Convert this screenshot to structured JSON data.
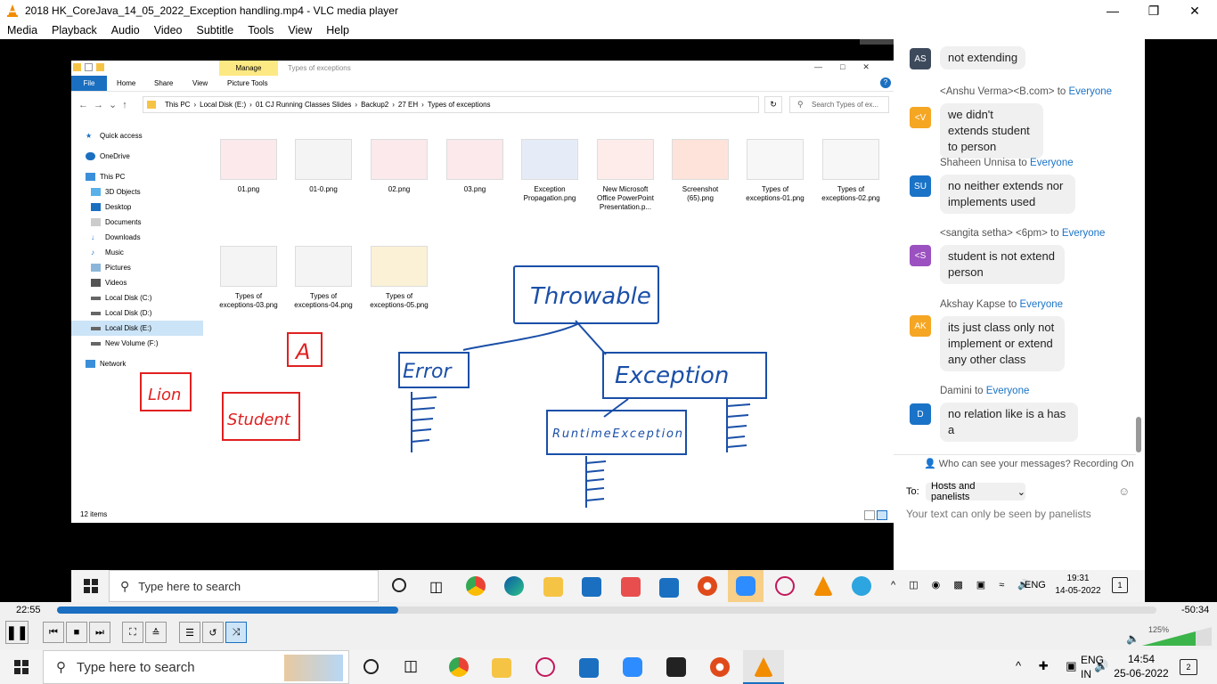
{
  "window": {
    "title": "2018 HK_CoreJava_14_05_2022_Exception handling.mp4 - VLC media player"
  },
  "menu": [
    "Media",
    "Playback",
    "Audio",
    "Video",
    "Subtitle",
    "Tools",
    "View",
    "Help"
  ],
  "explorer": {
    "ribbon_manage": "Manage",
    "ribbon_title": "Types of exceptions",
    "tabs": [
      "File",
      "Home",
      "Share",
      "View",
      "Picture Tools"
    ],
    "breadcrumb": [
      "This PC",
      "Local Disk (E:)",
      "01 CJ Running Classes Slides",
      "Backup2",
      "27 EH",
      "Types of exceptions"
    ],
    "search_placeholder": "Search Types of ex...",
    "nav": [
      "Quick access",
      "OneDrive",
      "This PC",
      "3D Objects",
      "Desktop",
      "Documents",
      "Downloads",
      "Music",
      "Pictures",
      "Videos",
      "Local Disk (C:)",
      "Local Disk (D:)",
      "Local Disk (E:)",
      "New Volume (F:)",
      "Network"
    ],
    "files": [
      "01.png",
      "01-0.png",
      "02.png",
      "03.png",
      "Exception Propagation.png",
      "New Microsoft Office PowerPoint Presentation.p...",
      "Screenshot (65).png",
      "Types of exceptions-01.png",
      "Types of exceptions-02.png",
      "Types of exceptions-03.png",
      "Types of exceptions-04.png",
      "Types of exceptions-05.png"
    ],
    "status": "12 items"
  },
  "drawing": {
    "throwable": "Throwable",
    "error": "Error",
    "exception": "Exception",
    "runtime": "RuntimeException",
    "a": "A",
    "lion": "Lion",
    "student": "Student"
  },
  "chat": {
    "messages": [
      {
        "avatar": "AS",
        "color": "#3d4a5c",
        "sender": "",
        "text": "not extending"
      },
      {
        "avatar": "<V",
        "color": "#f5a623",
        "sender": "<Anshu Verma><B.com> to ",
        "text": "we didn't extends student to person"
      },
      {
        "avatar": "SU",
        "color": "#1a73c7",
        "sender": "Shaheen Unnisa to ",
        "text": "no  neither extends nor implements used"
      },
      {
        "avatar": "<S",
        "color": "#9b51c0",
        "sender": "<sangita setha> <6pm> to ",
        "text": "student is not extend person"
      },
      {
        "avatar": "AK",
        "color": "#f5a623",
        "sender": "Akshay Kapse to ",
        "text": "its just class only not implement or extend any other class"
      },
      {
        "avatar": "D",
        "color": "#1a73c7",
        "sender": "Damini to ",
        "text": "no relation  like is a has a"
      }
    ],
    "everyone": "Everyone",
    "privacy": "Who can see your messages? Recording On",
    "to_label": "To:",
    "to_value": "Hosts and panelists",
    "input_placeholder": "Your text can only be seen by panelists"
  },
  "inner_taskbar": {
    "search": "Type here to search",
    "lang": "ENG",
    "time": "19:31",
    "date": "14-05-2022",
    "notif": "1"
  },
  "player": {
    "elapsed": "22:55",
    "remaining": "-50:34",
    "progress": 0.31,
    "volume": "125%"
  },
  "outer_taskbar": {
    "search": "Type here to search",
    "lang": "ENG",
    "region": "IN",
    "time": "14:54",
    "date": "25-06-2022",
    "notif": "2"
  }
}
